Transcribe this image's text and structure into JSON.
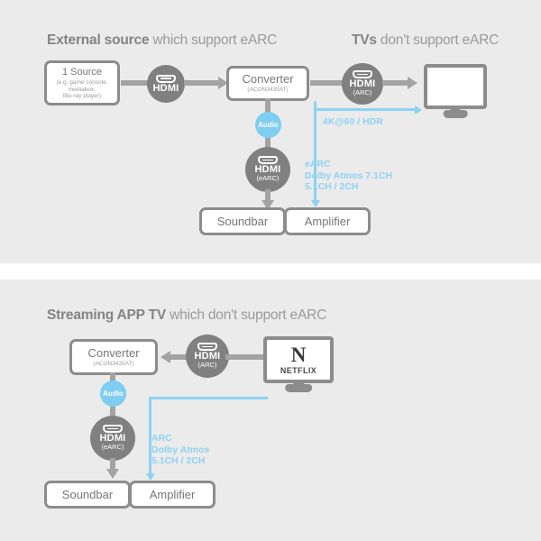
{
  "colors": {
    "panel_bg": "#ebebeb",
    "page_bg": "#ffffff",
    "gray": "#8c8c8c",
    "connector_gray": "#a3a3a3",
    "blue": "#8ed2f2",
    "audio_badge_blue": "#7fcdf0",
    "text_gray": "#7d7d7d"
  },
  "section_top": {
    "heading_left_strong": "External source",
    "heading_left_light": " which support eARC",
    "heading_right_strong": "TVs",
    "heading_right_light": " don't support eARC",
    "source_box": {
      "title": "1 Source",
      "subtitle": "(e.g. game console,\nmediabox,\nBlu-ray player)"
    },
    "hdmi_badge_1": {
      "label": "HDMI",
      "sublabel": "",
      "icon": "hdmi-plug-icon"
    },
    "converter_box": {
      "title": "Converter",
      "subtitle": "(ACON3435AT)"
    },
    "hdmi_badge_arc": {
      "label": "HDMI",
      "sublabel": "(ARC)",
      "icon": "hdmi-plug-icon"
    },
    "tv": {
      "icon": "tv-monitor-icon",
      "label": ""
    },
    "audio_badge": {
      "label": "Audio"
    },
    "hdmi_badge_earc": {
      "label": "HDMI",
      "sublabel": "(eARC)",
      "icon": "hdmi-plug-icon"
    },
    "soundbar_box": {
      "title": "Soundbar"
    },
    "amplifier_box": {
      "title": "Amplifier"
    },
    "video_label": "4K@60 / HDR",
    "audio_spec_label": "eARC\nDolby Atmos 7.1CH\n5.1CH / 2CH"
  },
  "section_bottom": {
    "heading_strong": "Streaming APP TV",
    "heading_light": " which don't support eARC",
    "converter_box": {
      "title": "Converter",
      "subtitle": "(ACON3435AT)"
    },
    "hdmi_badge_arc": {
      "label": "HDMI",
      "sublabel": "(ARC)",
      "icon": "hdmi-plug-icon"
    },
    "tv": {
      "icon": "tv-monitor-icon",
      "logo_mark": "N",
      "logo_word": "NETFLIX"
    },
    "audio_badge": {
      "label": "Audio"
    },
    "hdmi_badge_earc": {
      "label": "HDMI",
      "sublabel": "(eARC)",
      "icon": "hdmi-plug-icon"
    },
    "soundbar_box": {
      "title": "Soundbar"
    },
    "amplifier_box": {
      "title": "Amplifier"
    },
    "audio_spec_label": "ARC\nDolby Atmos\n5.1CH / 2CH"
  }
}
